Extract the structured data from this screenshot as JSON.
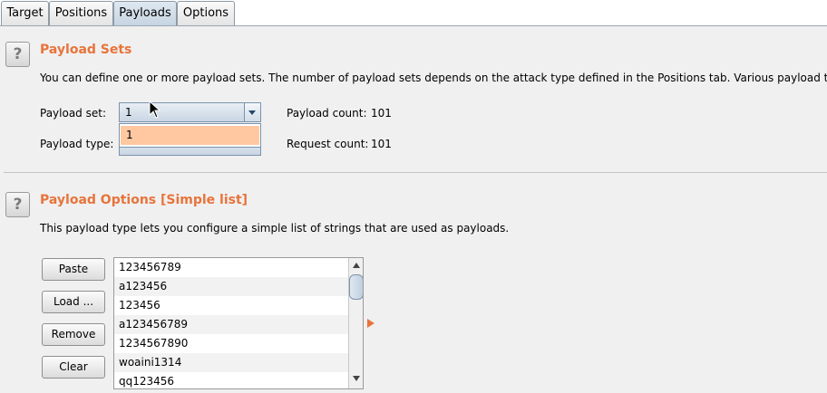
{
  "tabs": [
    {
      "label": "Target"
    },
    {
      "label": "Positions"
    },
    {
      "label": "Payloads"
    },
    {
      "label": "Options"
    }
  ],
  "payload_sets": {
    "title": "Payload Sets",
    "description": "You can define one or more payload sets. The number of payload sets depends on the attack type defined in the Positions tab. Various payload types",
    "payload_set_label": "Payload set:",
    "payload_set_value": "1",
    "dropdown_option": "1",
    "payload_type_label": "Payload type:",
    "payload_count_label": "Payload count:",
    "payload_count_value": "101",
    "request_count_label": "Request count:",
    "request_count_value": "101"
  },
  "payload_options": {
    "title": "Payload Options [Simple list]",
    "description": "This payload type lets you configure a simple list of strings that are used as payloads.",
    "buttons": {
      "paste": "Paste",
      "load": "Load ...",
      "remove": "Remove",
      "clear": "Clear"
    },
    "items": [
      "123456789",
      "a123456",
      "123456",
      "a123456789",
      "1234567890",
      "woaini1314",
      "qq123456"
    ]
  },
  "help_icon_text": "?",
  "colors": {
    "accent": "#e8743b",
    "selected_option": "#ffc8a0"
  }
}
